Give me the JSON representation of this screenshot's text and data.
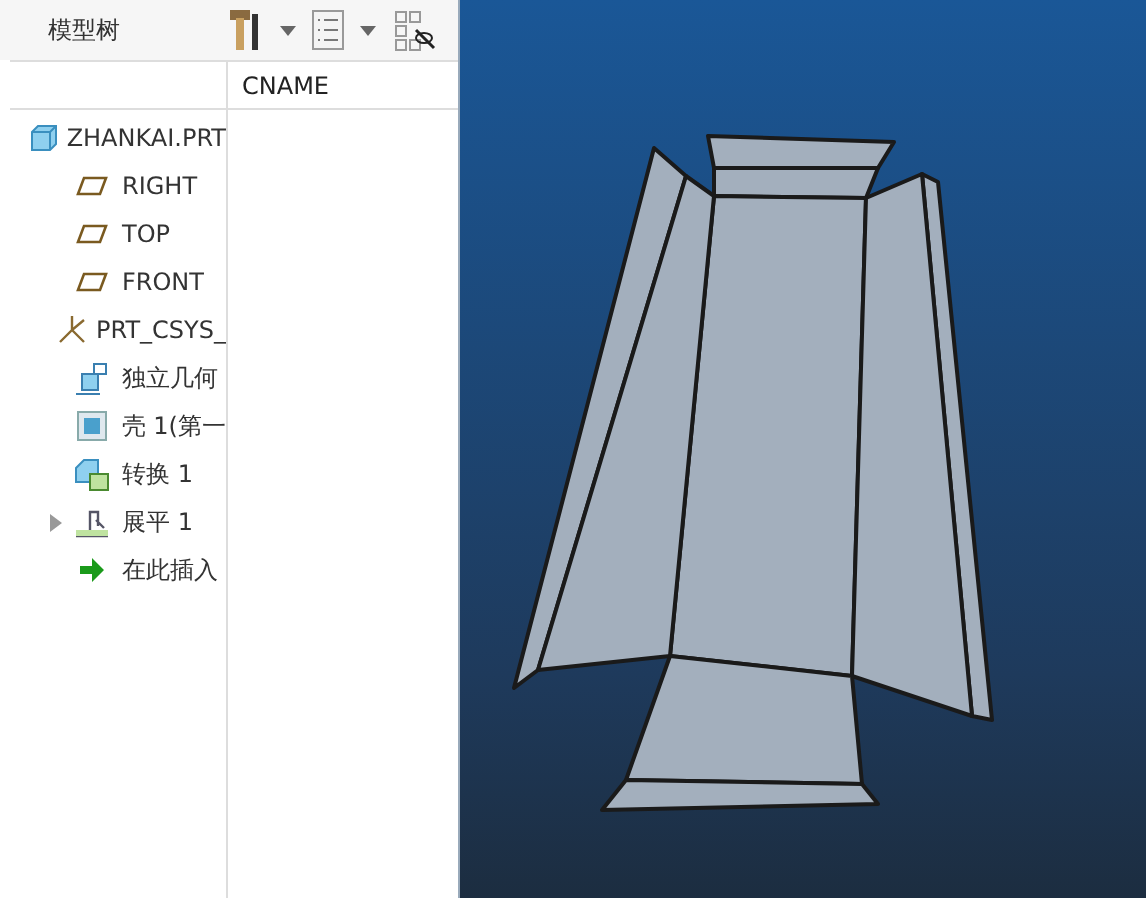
{
  "panel": {
    "title": "模型树"
  },
  "columns": [
    "CNAME"
  ],
  "tree": [
    {
      "label": "ZHANKAI.PRT",
      "kind": "part",
      "children": [
        {
          "label": "RIGHT",
          "kind": "plane"
        },
        {
          "label": "TOP",
          "kind": "plane"
        },
        {
          "label": "FRONT",
          "kind": "plane"
        },
        {
          "label": "PRT_CSYS_",
          "kind": "csys"
        },
        {
          "label": "独立几何",
          "kind": "geometry"
        },
        {
          "label": "壳 1(第一",
          "kind": "shell"
        },
        {
          "label": "转换 1",
          "kind": "convert"
        },
        {
          "label": "展平 1",
          "kind": "flatten",
          "expanded": false
        },
        {
          "label": "在此插入",
          "kind": "insert"
        }
      ]
    }
  ]
}
